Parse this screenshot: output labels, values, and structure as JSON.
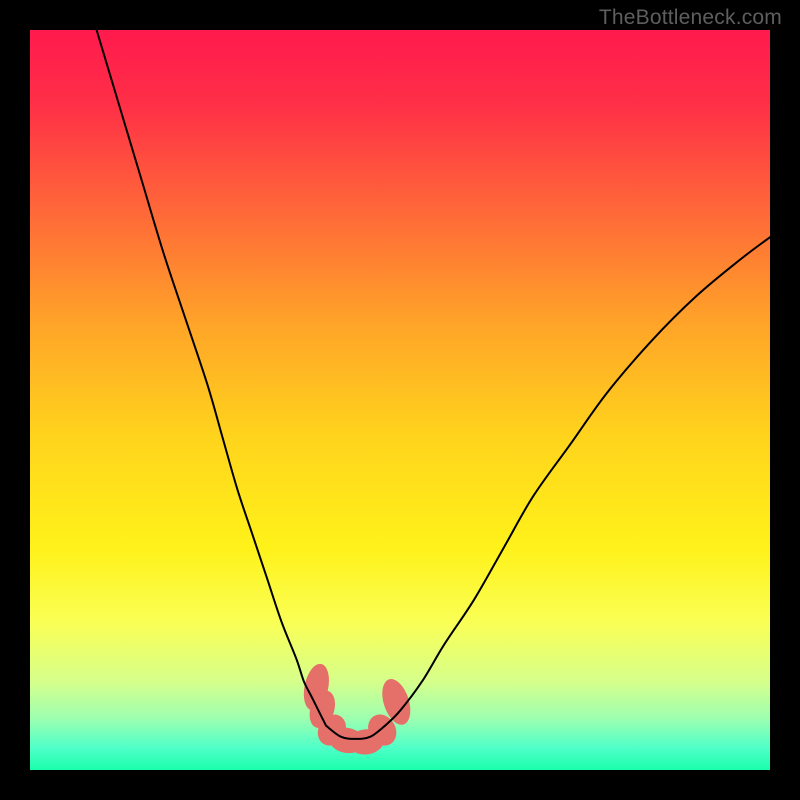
{
  "watermark": "TheBottleneck.com",
  "chart_data": {
    "type": "line",
    "title": "",
    "xlabel": "",
    "ylabel": "",
    "xlim": [
      0,
      100
    ],
    "ylim": [
      0,
      100
    ],
    "grid": false,
    "background_gradient": {
      "stops": [
        {
          "offset": 0.0,
          "color": "#ff1a4d"
        },
        {
          "offset": 0.1,
          "color": "#ff2f47"
        },
        {
          "offset": 0.25,
          "color": "#ff6a38"
        },
        {
          "offset": 0.4,
          "color": "#ffa528"
        },
        {
          "offset": 0.55,
          "color": "#ffd41c"
        },
        {
          "offset": 0.7,
          "color": "#fff21a"
        },
        {
          "offset": 0.8,
          "color": "#faff55"
        },
        {
          "offset": 0.88,
          "color": "#d6ff8a"
        },
        {
          "offset": 0.93,
          "color": "#9effb0"
        },
        {
          "offset": 0.97,
          "color": "#4fffc8"
        },
        {
          "offset": 1.0,
          "color": "#1affac"
        }
      ]
    },
    "series": [
      {
        "name": "left-arm",
        "color": "#000000",
        "width": 2,
        "x": [
          9,
          12,
          15,
          18,
          21,
          24,
          26,
          28,
          30,
          32,
          34,
          36,
          37,
          38,
          39,
          40
        ],
        "y": [
          100,
          90,
          80,
          70,
          61,
          52,
          45,
          38,
          32,
          26,
          20,
          15,
          12,
          10,
          8,
          6
        ]
      },
      {
        "name": "right-arm",
        "color": "#000000",
        "width": 2,
        "x": [
          48,
          50,
          53,
          56,
          60,
          64,
          68,
          73,
          78,
          84,
          90,
          96,
          100
        ],
        "y": [
          6,
          8,
          12,
          17,
          23,
          30,
          37,
          44,
          51,
          58,
          64,
          69,
          72
        ]
      },
      {
        "name": "valley-floor",
        "color": "#000000",
        "width": 2,
        "x": [
          40,
          42,
          44,
          46,
          48
        ],
        "y": [
          6,
          4.5,
          4.2,
          4.5,
          6
        ]
      }
    ],
    "markers": [
      {
        "name": "left-upper-blob",
        "cx": 38.7,
        "cy": 11.2,
        "rx": 1.6,
        "ry": 3.2,
        "rot": 12,
        "color": "#e5706a"
      },
      {
        "name": "left-upper-blob2",
        "cx": 39.5,
        "cy": 8.2,
        "rx": 1.6,
        "ry": 2.6,
        "rot": 18,
        "color": "#e5706a"
      },
      {
        "name": "left-lower-blob",
        "cx": 40.8,
        "cy": 5.4,
        "rx": 1.8,
        "ry": 2.2,
        "rot": 30,
        "color": "#e5706a"
      },
      {
        "name": "floor-blob-1",
        "cx": 42.8,
        "cy": 4.0,
        "rx": 2.4,
        "ry": 1.7,
        "rot": 10,
        "color": "#e5706a"
      },
      {
        "name": "floor-blob-2",
        "cx": 45.4,
        "cy": 3.8,
        "rx": 2.4,
        "ry": 1.7,
        "rot": -6,
        "color": "#e5706a"
      },
      {
        "name": "right-lower-blob",
        "cx": 47.6,
        "cy": 5.4,
        "rx": 1.8,
        "ry": 2.2,
        "rot": -30,
        "color": "#e5706a"
      },
      {
        "name": "right-upper-blob",
        "cx": 49.5,
        "cy": 9.2,
        "rx": 1.7,
        "ry": 3.2,
        "rot": -18,
        "color": "#e5706a"
      }
    ]
  }
}
